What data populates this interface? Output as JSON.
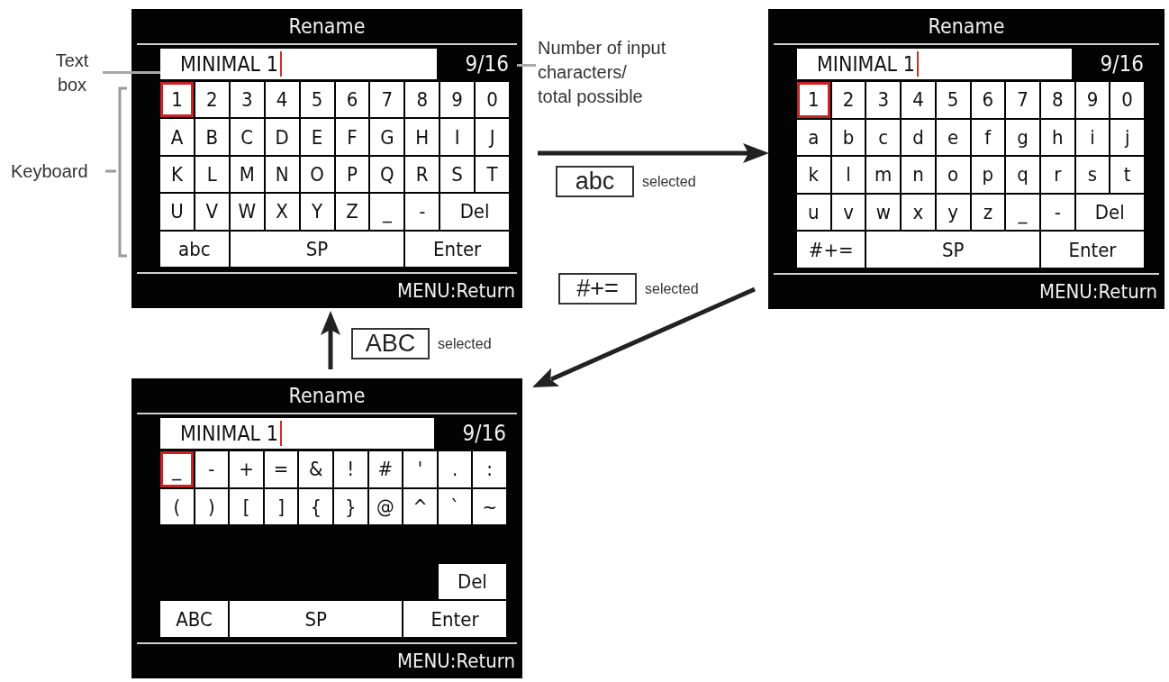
{
  "callouts": [
    {
      "kind": "text_box",
      "text": "Text\nbox"
    },
    {
      "kind": "keyboard",
      "text": "Keyboard"
    },
    {
      "kind": "counter",
      "text": "Number of input\ncharacters/\ntotal possible"
    }
  ],
  "screens": [
    {
      "title": "Rename",
      "text_field": {
        "value": "MINIMAL 1"
      },
      "counter": "9/16",
      "keyboard": {
        "keys": [
          {
            "label": "1",
            "kind": "char",
            "selected": true
          },
          {
            "label": "2",
            "kind": "char",
            "selected": false
          },
          {
            "label": "3",
            "kind": "char",
            "selected": false
          },
          {
            "label": "4",
            "kind": "char",
            "selected": false
          },
          {
            "label": "5",
            "kind": "char",
            "selected": false
          },
          {
            "label": "6",
            "kind": "char",
            "selected": false
          },
          {
            "label": "7",
            "kind": "char",
            "selected": false
          },
          {
            "label": "8",
            "kind": "char",
            "selected": false
          },
          {
            "label": "9",
            "kind": "char",
            "selected": false
          },
          {
            "label": "0",
            "kind": "char",
            "selected": false
          },
          {
            "label": "A",
            "kind": "char",
            "selected": false
          },
          {
            "label": "B",
            "kind": "char",
            "selected": false
          },
          {
            "label": "C",
            "kind": "char",
            "selected": false
          },
          {
            "label": "D",
            "kind": "char",
            "selected": false
          },
          {
            "label": "E",
            "kind": "char",
            "selected": false
          },
          {
            "label": "F",
            "kind": "char",
            "selected": false
          },
          {
            "label": "G",
            "kind": "char",
            "selected": false
          },
          {
            "label": "H",
            "kind": "char",
            "selected": false
          },
          {
            "label": "I",
            "kind": "char",
            "selected": false
          },
          {
            "label": "J",
            "kind": "char",
            "selected": false
          },
          {
            "label": "K",
            "kind": "char",
            "selected": false
          },
          {
            "label": "L",
            "kind": "char",
            "selected": false
          },
          {
            "label": "M",
            "kind": "char",
            "selected": false
          },
          {
            "label": "N",
            "kind": "char",
            "selected": false
          },
          {
            "label": "O",
            "kind": "char",
            "selected": false
          },
          {
            "label": "P",
            "kind": "char",
            "selected": false
          },
          {
            "label": "Q",
            "kind": "char",
            "selected": false
          },
          {
            "label": "R",
            "kind": "char",
            "selected": false
          },
          {
            "label": "S",
            "kind": "char",
            "selected": false
          },
          {
            "label": "T",
            "kind": "char",
            "selected": false
          },
          {
            "label": "U",
            "kind": "char",
            "selected": false
          },
          {
            "label": "V",
            "kind": "char",
            "selected": false
          },
          {
            "label": "W",
            "kind": "char",
            "selected": false
          },
          {
            "label": "X",
            "kind": "char",
            "selected": false
          },
          {
            "label": "Y",
            "kind": "char",
            "selected": false
          },
          {
            "label": "Z",
            "kind": "char",
            "selected": false
          },
          {
            "label": "_",
            "kind": "char",
            "selected": false
          },
          {
            "label": "-",
            "kind": "char",
            "selected": false
          },
          {
            "label": "Del",
            "kind": "del",
            "selected": false
          },
          {
            "label": "abc",
            "kind": "mode",
            "selected": false
          },
          {
            "label": "SP",
            "kind": "space",
            "selected": false
          },
          {
            "label": "Enter",
            "kind": "enter",
            "selected": false
          }
        ]
      },
      "footer": "MENU:Return"
    },
    {
      "title": "Rename",
      "text_field": {
        "value": "MINIMAL 1"
      },
      "counter": "9/16",
      "keyboard": {
        "keys": [
          {
            "label": "1",
            "kind": "char",
            "selected": true
          },
          {
            "label": "2",
            "kind": "char",
            "selected": false
          },
          {
            "label": "3",
            "kind": "char",
            "selected": false
          },
          {
            "label": "4",
            "kind": "char",
            "selected": false
          },
          {
            "label": "5",
            "kind": "char",
            "selected": false
          },
          {
            "label": "6",
            "kind": "char",
            "selected": false
          },
          {
            "label": "7",
            "kind": "char",
            "selected": false
          },
          {
            "label": "8",
            "kind": "char",
            "selected": false
          },
          {
            "label": "9",
            "kind": "char",
            "selected": false
          },
          {
            "label": "0",
            "kind": "char",
            "selected": false
          },
          {
            "label": "a",
            "kind": "char",
            "selected": false
          },
          {
            "label": "b",
            "kind": "char",
            "selected": false
          },
          {
            "label": "c",
            "kind": "char",
            "selected": false
          },
          {
            "label": "d",
            "kind": "char",
            "selected": false
          },
          {
            "label": "e",
            "kind": "char",
            "selected": false
          },
          {
            "label": "f",
            "kind": "char",
            "selected": false
          },
          {
            "label": "g",
            "kind": "char",
            "selected": false
          },
          {
            "label": "h",
            "kind": "char",
            "selected": false
          },
          {
            "label": "i",
            "kind": "char",
            "selected": false
          },
          {
            "label": "j",
            "kind": "char",
            "selected": false
          },
          {
            "label": "k",
            "kind": "char",
            "selected": false
          },
          {
            "label": "l",
            "kind": "char",
            "selected": false
          },
          {
            "label": "m",
            "kind": "char",
            "selected": false
          },
          {
            "label": "n",
            "kind": "char",
            "selected": false
          },
          {
            "label": "o",
            "kind": "char",
            "selected": false
          },
          {
            "label": "p",
            "kind": "char",
            "selected": false
          },
          {
            "label": "q",
            "kind": "char",
            "selected": false
          },
          {
            "label": "r",
            "kind": "char",
            "selected": false
          },
          {
            "label": "s",
            "kind": "char",
            "selected": false
          },
          {
            "label": "t",
            "kind": "char",
            "selected": false
          },
          {
            "label": "u",
            "kind": "char",
            "selected": false
          },
          {
            "label": "v",
            "kind": "char",
            "selected": false
          },
          {
            "label": "w",
            "kind": "char",
            "selected": false
          },
          {
            "label": "x",
            "kind": "char",
            "selected": false
          },
          {
            "label": "y",
            "kind": "char",
            "selected": false
          },
          {
            "label": "z",
            "kind": "char",
            "selected": false
          },
          {
            "label": "_",
            "kind": "char",
            "selected": false
          },
          {
            "label": "-",
            "kind": "char",
            "selected": false
          },
          {
            "label": "Del",
            "kind": "del",
            "selected": false
          },
          {
            "label": "#+=",
            "kind": "mode",
            "selected": false
          },
          {
            "label": "SP",
            "kind": "space",
            "selected": false
          },
          {
            "label": "Enter",
            "kind": "enter",
            "selected": false
          }
        ]
      },
      "footer": "MENU:Return"
    },
    {
      "title": "Rename",
      "text_field": {
        "value": "MINIMAL 1"
      },
      "counter": "9/16",
      "keyboard": {
        "keys": [
          {
            "label": "_",
            "kind": "char",
            "selected": true
          },
          {
            "label": "-",
            "kind": "char",
            "selected": false
          },
          {
            "label": "+",
            "kind": "char",
            "selected": false
          },
          {
            "label": "=",
            "kind": "char",
            "selected": false
          },
          {
            "label": "&",
            "kind": "char",
            "selected": false
          },
          {
            "label": "!",
            "kind": "char",
            "selected": false
          },
          {
            "label": "#",
            "kind": "char",
            "selected": false
          },
          {
            "label": "'",
            "kind": "char",
            "selected": false
          },
          {
            "label": ".",
            "kind": "char",
            "selected": false
          },
          {
            "label": ":",
            "kind": "char",
            "selected": false
          },
          {
            "label": "(",
            "kind": "char",
            "selected": false
          },
          {
            "label": ")",
            "kind": "char",
            "selected": false
          },
          {
            "label": "[",
            "kind": "char",
            "selected": false
          },
          {
            "label": "]",
            "kind": "char",
            "selected": false
          },
          {
            "label": "{",
            "kind": "char",
            "selected": false
          },
          {
            "label": "}",
            "kind": "char",
            "selected": false
          },
          {
            "label": "@",
            "kind": "char",
            "selected": false
          },
          {
            "label": "^",
            "kind": "char",
            "selected": false
          },
          {
            "label": "`",
            "kind": "char",
            "selected": false
          },
          {
            "label": "~",
            "kind": "char",
            "selected": false
          },
          {
            "label": "Del",
            "kind": "del",
            "selected": false
          },
          {
            "label": "ABC",
            "kind": "mode",
            "selected": false
          },
          {
            "label": "SP",
            "kind": "space",
            "selected": false
          },
          {
            "label": "Enter",
            "kind": "enter",
            "selected": false
          }
        ]
      },
      "footer": "MENU:Return"
    }
  ],
  "transitions": [
    {
      "key": "abc",
      "caption": "selected"
    },
    {
      "key": "#+=",
      "caption": "selected"
    },
    {
      "key": "ABC",
      "caption": "selected"
    }
  ]
}
